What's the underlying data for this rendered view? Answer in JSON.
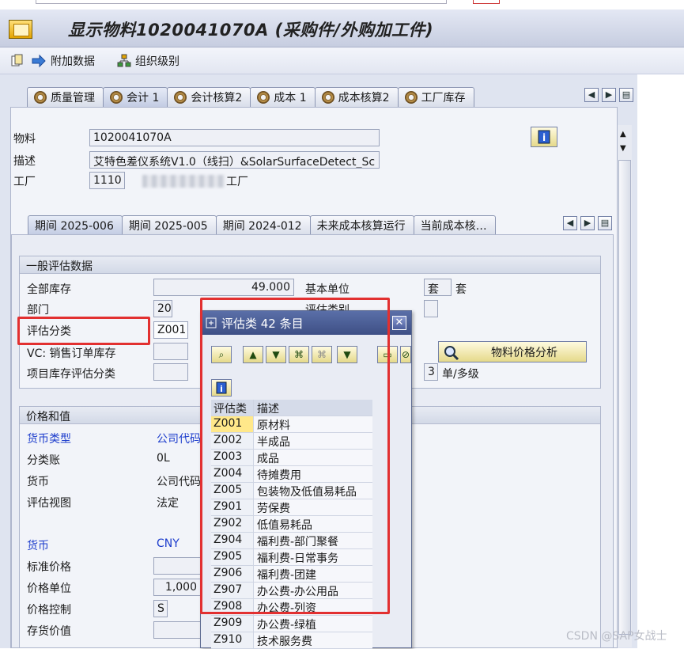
{
  "title": "显示物料1020041070A (采购件/外购加工件)",
  "toolbar": {
    "additional_data": "附加数据",
    "org_levels": "组织级别"
  },
  "main_tabs": [
    "质量管理",
    "会计 1",
    "会计核算2",
    "成本 1",
    "成本核算2",
    "工厂库存"
  ],
  "header": {
    "material_label": "物料",
    "material_value": "1020041070A",
    "desc_label": "描述",
    "desc_value": "艾特色差仪系统V1.0（线扫）&SolarSurfaceDetect_Sc",
    "plant_label": "工厂",
    "plant_value": "1110",
    "plant_name_tail": "工厂"
  },
  "period_tabs": [
    "期间 2025-006",
    "期间 2025-005",
    "期间 2024-012",
    "未来成本核算运行",
    "当前成本核…"
  ],
  "general": {
    "header": "一般评估数据",
    "total_stock_label": "全部库存",
    "total_stock_value": "49.000",
    "base_unit_label": "基本单位",
    "base_unit_value": "套",
    "base_unit_text": "套",
    "division_label": "部门",
    "division_value": "20",
    "val_cat_label": "评估类别",
    "val_class_label": "评估分类",
    "val_class_value": "Z001",
    "vc_label": "VC: 销售订单库存",
    "proj_label": "项目库存评估分类",
    "price_analysis_button": "物料价格分析",
    "ml_value": "3",
    "ml_text": "单/多级"
  },
  "prices": {
    "header": "价格和值",
    "currency_type_label": "货币类型",
    "currency_type_value": "公司代码",
    "ledger_label": "分类账",
    "ledger_value": "0L",
    "currency_label": "货币",
    "currency_value": "公司代码",
    "view_label": "评估视图",
    "view_value": "法定",
    "currency2_label": "货币",
    "currency2_value": "CNY",
    "std_price_label": "标准价格",
    "price_unit_label": "价格单位",
    "price_unit_value": "1,000",
    "price_ctrl_label": "价格控制",
    "price_ctrl_value": "S",
    "inv_value_label": "存货价值"
  },
  "popup": {
    "title": "评估类 42 条目",
    "col_class": "评估类",
    "col_desc": "描述",
    "rows": [
      [
        "Z001",
        "原材料"
      ],
      [
        "Z002",
        "半成品"
      ],
      [
        "Z003",
        "成品"
      ],
      [
        "Z004",
        "待摊费用"
      ],
      [
        "Z005",
        "包装物及低值易耗品"
      ],
      [
        "Z901",
        "劳保费"
      ],
      [
        "Z902",
        "低值易耗品"
      ],
      [
        "Z904",
        "福利费-部门聚餐"
      ],
      [
        "Z905",
        "福利费-日常事务"
      ],
      [
        "Z906",
        "福利费-团建"
      ],
      [
        "Z907",
        "办公费-办公用品"
      ],
      [
        "Z908",
        "办公费-列资"
      ],
      [
        "Z909",
        "办公费-绿植"
      ],
      [
        "Z910",
        "技术服务费"
      ]
    ]
  },
  "watermark": "CSDN @SAP女战士"
}
